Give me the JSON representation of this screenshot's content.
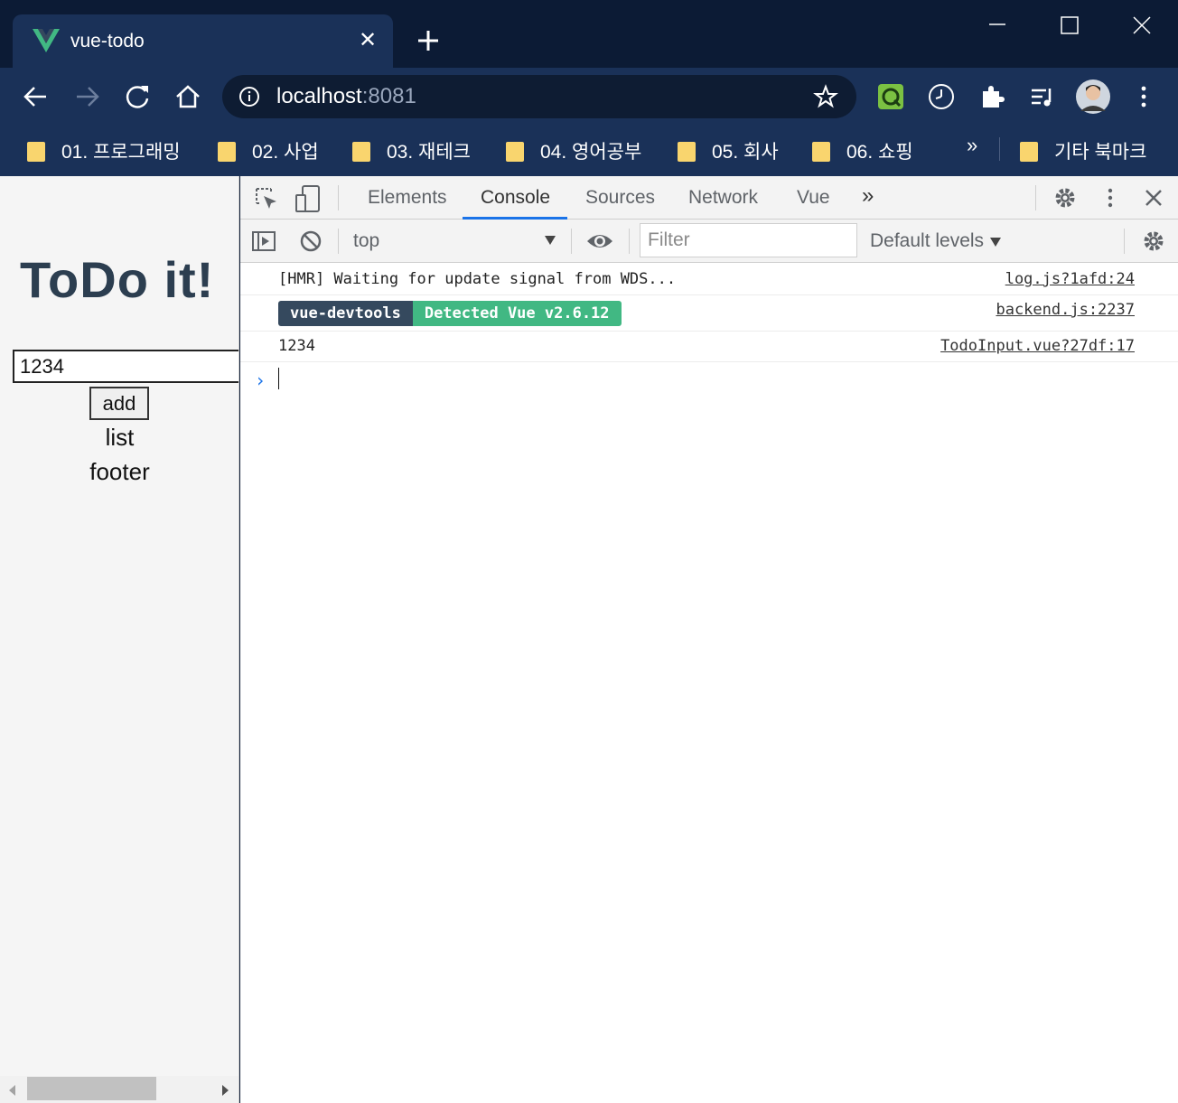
{
  "window": {
    "tab_title": "vue-todo",
    "tab_close_glyph": "✕",
    "controls": [
      "minimize-icon",
      "maximize-icon",
      "close-icon"
    ]
  },
  "toolbar": {
    "url_host": "localhost",
    "url_port": ":8081",
    "icons": [
      "back-icon",
      "forward-icon",
      "reload-icon",
      "home-icon",
      "info-icon",
      "star-icon",
      "extension-green-icon",
      "clock-icon",
      "puzzle-icon",
      "media-queue-icon",
      "avatar",
      "menu-icon"
    ]
  },
  "bookmarks": {
    "items": [
      {
        "label": "01. 프로그래밍"
      },
      {
        "label": "02. 사업"
      },
      {
        "label": "03. 재테크"
      },
      {
        "label": "04. 영어공부"
      },
      {
        "label": "05. 회사"
      },
      {
        "label": "06. 쇼핑"
      }
    ],
    "more": "»",
    "other": "기타 북마크"
  },
  "page": {
    "title": "ToDo it!",
    "input_value": "1234",
    "add_label": "add",
    "list_text": "list",
    "footer_text": "footer"
  },
  "devtools": {
    "tabs": [
      "Elements",
      "Console",
      "Sources",
      "Network",
      "Vue"
    ],
    "active_tab": "Console",
    "more_tabs": "»",
    "context": "top",
    "filter_placeholder": "Filter",
    "levels": "Default levels",
    "logs": [
      {
        "message": "[HMR] Waiting for update signal from WDS...",
        "source": "log.js?1afd:24"
      },
      {
        "badge_left": "vue-devtools",
        "badge_right": "Detected Vue v2.6.12",
        "source": "backend.js:2237"
      },
      {
        "message": "1234",
        "source": "TodoInput.vue?27df:17"
      }
    ],
    "prompt": "›"
  },
  "colors": {
    "titlebar": "#0c1b35",
    "toolbar": "#1a3158",
    "vue_green": "#41b883",
    "vue_dark": "#35495e",
    "accent_blue": "#1a73e8",
    "title_text": "#2c3e50"
  }
}
